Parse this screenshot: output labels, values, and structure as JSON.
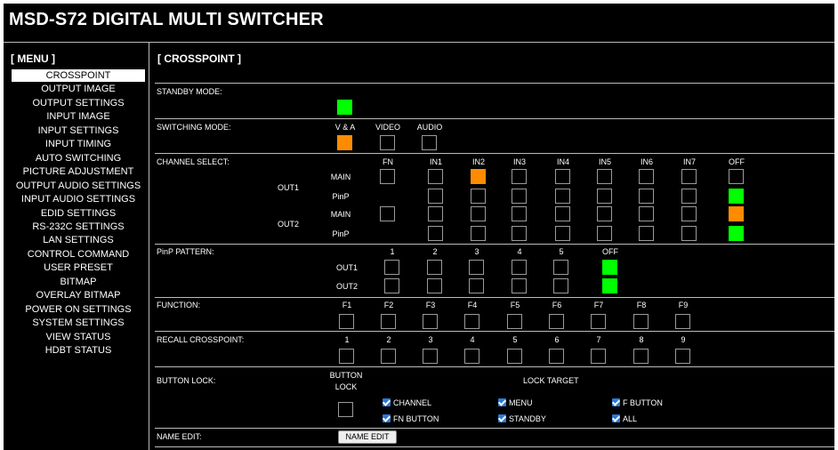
{
  "app_title": "MSD-S72 DIGITAL MULTI SWITCHER",
  "menu": {
    "heading": "[ MENU ]",
    "items": [
      {
        "label": "CROSSPOINT",
        "active": true
      },
      {
        "label": "OUTPUT IMAGE"
      },
      {
        "label": "OUTPUT SETTINGS"
      },
      {
        "label": "INPUT IMAGE"
      },
      {
        "label": "INPUT SETTINGS"
      },
      {
        "label": "INPUT TIMING"
      },
      {
        "label": "AUTO SWITCHING"
      },
      {
        "label": "PICTURE ADJUSTMENT"
      },
      {
        "label": "OUTPUT AUDIO SETTINGS"
      },
      {
        "label": "INPUT AUDIO SETTINGS"
      },
      {
        "label": "EDID SETTINGS"
      },
      {
        "label": "RS-232C SETTINGS"
      },
      {
        "label": "LAN SETTINGS"
      },
      {
        "label": "CONTROL COMMAND"
      },
      {
        "label": "USER PRESET"
      },
      {
        "label": "BITMAP"
      },
      {
        "label": "OVERLAY BITMAP"
      },
      {
        "label": "POWER ON SETTINGS"
      },
      {
        "label": "SYSTEM SETTINGS"
      },
      {
        "label": "VIEW STATUS"
      },
      {
        "label": "HDBT STATUS"
      }
    ]
  },
  "section_title": "[ CROSSPOINT ]",
  "colors": {
    "active_green": "#00ff00",
    "selected_orange": "#ff8c00",
    "checkbox_blue": "#2a7ad8"
  },
  "standby": {
    "label": "STANDBY MODE:",
    "state": "on"
  },
  "switching": {
    "label": "SWITCHING MODE:",
    "options": [
      {
        "label": "V & A",
        "state": "selected"
      },
      {
        "label": "VIDEO",
        "state": "off"
      },
      {
        "label": "AUDIO",
        "state": "off"
      }
    ]
  },
  "channel_select": {
    "label": "CHANNEL SELECT:",
    "columns": [
      "FN",
      "IN1",
      "IN2",
      "IN3",
      "IN4",
      "IN5",
      "IN6",
      "IN7",
      "OFF"
    ],
    "outputs": [
      {
        "name": "OUT1",
        "rows": [
          {
            "name": "MAIN",
            "states": [
              "off",
              "off",
              "selected",
              "off",
              "off",
              "off",
              "off",
              "off",
              "off"
            ]
          },
          {
            "name": "PinP",
            "states": [
              null,
              "off",
              "off",
              "off",
              "off",
              "off",
              "off",
              "off",
              "on"
            ]
          }
        ]
      },
      {
        "name": "OUT2",
        "rows": [
          {
            "name": "MAIN",
            "states": [
              "off",
              "off",
              "off",
              "off",
              "off",
              "off",
              "off",
              "off",
              "selected"
            ]
          },
          {
            "name": "PinP",
            "states": [
              null,
              "off",
              "off",
              "off",
              "off",
              "off",
              "off",
              "off",
              "on"
            ]
          }
        ]
      }
    ]
  },
  "pinp_pattern": {
    "label": "PinP PATTERN:",
    "columns": [
      "1",
      "2",
      "3",
      "4",
      "5",
      "OFF"
    ],
    "rows": [
      {
        "name": "OUT1",
        "states": [
          "off",
          "off",
          "off",
          "off",
          "off",
          "on"
        ]
      },
      {
        "name": "OUT2",
        "states": [
          "off",
          "off",
          "off",
          "off",
          "off",
          "on"
        ]
      }
    ]
  },
  "function": {
    "label": "FUNCTION:",
    "buttons": [
      "F1",
      "F2",
      "F3",
      "F4",
      "F5",
      "F6",
      "F7",
      "F8",
      "F9"
    ]
  },
  "recall": {
    "label": "RECALL CROSSPOINT:",
    "buttons": [
      "1",
      "2",
      "3",
      "4",
      "5",
      "6",
      "7",
      "8",
      "9"
    ]
  },
  "button_lock": {
    "label": "BUTTON LOCK:",
    "lock_label_line1": "BUTTON",
    "lock_label_line2": "LOCK",
    "target_label": "LOCK TARGET",
    "targets": [
      {
        "label": "CHANNEL",
        "checked": true
      },
      {
        "label": "MENU",
        "checked": true
      },
      {
        "label": "F BUTTON",
        "checked": true
      },
      {
        "label": "FN BUTTON",
        "checked": true
      },
      {
        "label": "STANDBY",
        "checked": true
      },
      {
        "label": "ALL",
        "checked": true
      }
    ]
  },
  "name_edit": {
    "label": "NAME EDIT:",
    "button": "NAME EDIT"
  }
}
